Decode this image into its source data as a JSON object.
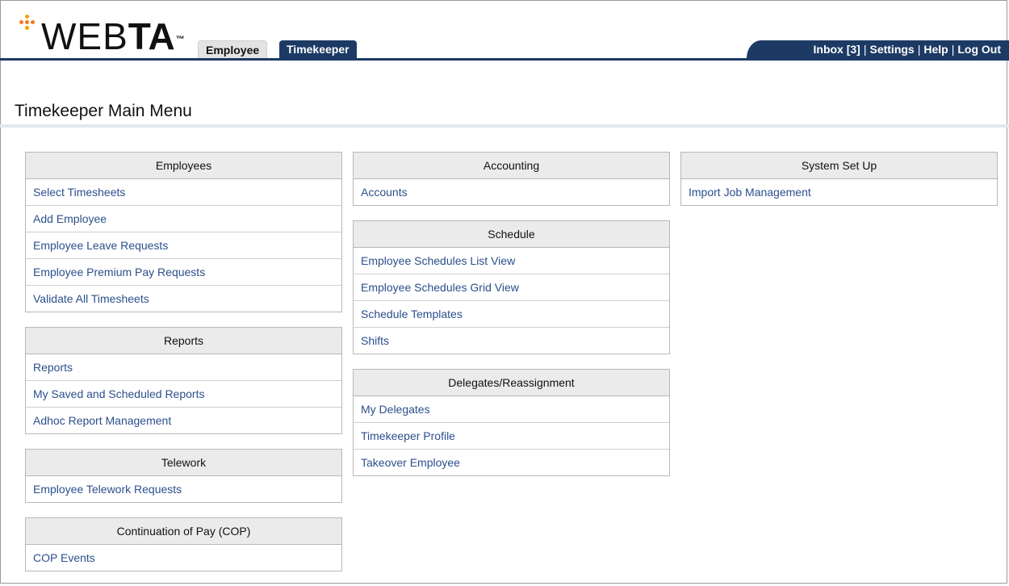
{
  "logo": {
    "text_light": "WEB",
    "text_bold": "TA",
    "trademark": "™",
    "dot_colors": [
      "#f47b20",
      "#f7a100",
      "#f47b20",
      "#f7a100",
      "#f47b20"
    ]
  },
  "tabs": [
    {
      "label": "Employee"
    },
    {
      "label": "Timekeeper"
    }
  ],
  "user_nav": {
    "inbox": "Inbox [3]",
    "settings": "Settings",
    "help": "Help",
    "logout": "Log Out",
    "separator": "|"
  },
  "page_title": "Timekeeper Main Menu",
  "columns": [
    {
      "panels": [
        {
          "title": "Employees",
          "items": [
            "Select Timesheets",
            "Add Employee",
            "Employee Leave Requests",
            "Employee Premium Pay Requests",
            "Validate All Timesheets"
          ]
        },
        {
          "title": "Reports",
          "items": [
            "Reports",
            "My Saved and Scheduled Reports",
            "Adhoc Report Management"
          ]
        },
        {
          "title": "Telework",
          "items": [
            "Employee Telework Requests"
          ]
        },
        {
          "title": "Continuation of Pay (COP)",
          "items": [
            "COP Events"
          ]
        }
      ]
    },
    {
      "panels": [
        {
          "title": "Accounting",
          "items": [
            "Accounts"
          ]
        },
        {
          "title": "Schedule",
          "items": [
            "Employee Schedules List View",
            "Employee Schedules Grid View",
            "Schedule Templates",
            "Shifts"
          ]
        },
        {
          "title": "Delegates/Reassignment",
          "items": [
            "My Delegates",
            "Timekeeper Profile",
            "Takeover Employee"
          ]
        }
      ]
    },
    {
      "panels": [
        {
          "title": "System Set Up",
          "items": [
            "Import Job Management"
          ]
        }
      ]
    }
  ],
  "colors": {
    "brand_navy": "#1c3a64",
    "link": "#2c4f8c",
    "panel_header_bg": "#ebebeb"
  }
}
